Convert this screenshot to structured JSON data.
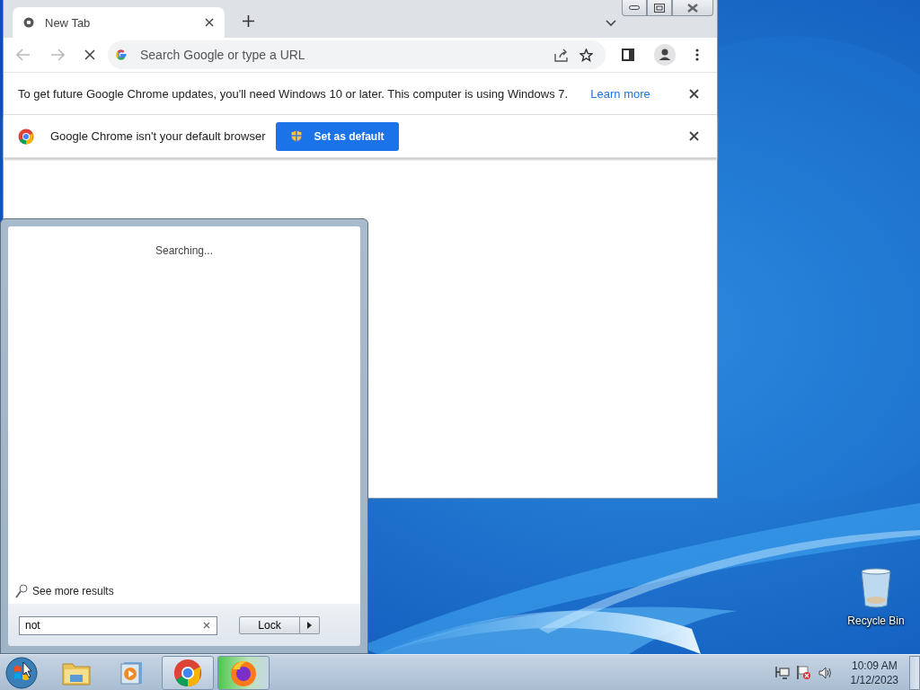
{
  "browser": {
    "tabs": [
      {
        "title": "New Tab",
        "selected": true
      }
    ],
    "omnibox": {
      "placeholder": "Search Google or type a URL"
    },
    "loading": true,
    "infobars": [
      {
        "kind": "notice",
        "text": "To get future Google Chrome updates, you'll need Windows 10 or later. This computer is using Windows 7.",
        "link": "Learn more"
      },
      {
        "kind": "default_browser",
        "text": "Google Chrome isn't your default browser",
        "button": "Set as default"
      }
    ]
  },
  "start_menu": {
    "status": "Searching...",
    "see_more": "See more results",
    "search": {
      "value": "not"
    },
    "power_button": "Lock"
  },
  "desktop_icons": [
    {
      "label": "Recycle Bin"
    }
  ],
  "taskbar": {
    "apps": [
      {
        "kind": "folder",
        "running": false
      },
      {
        "kind": "media",
        "running": false
      },
      {
        "kind": "chrome",
        "running": true
      },
      {
        "kind": "firefox",
        "running": true
      }
    ],
    "time": "10:09 AM",
    "date": "1/12/2023"
  }
}
